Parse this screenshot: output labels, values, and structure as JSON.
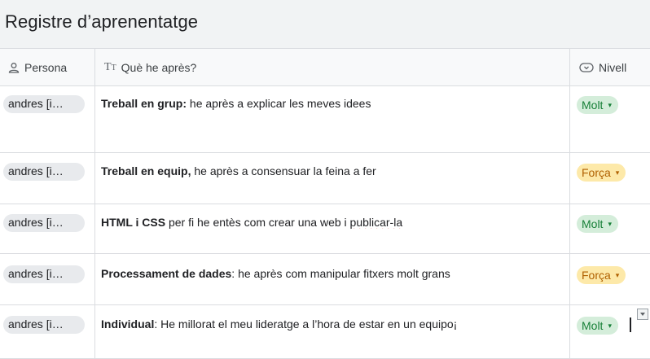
{
  "title": "Registre d’aprenentatge",
  "columns": {
    "persona": "Persona",
    "que": "Què he après?",
    "nivell": "Nivell"
  },
  "icons": {
    "persona": "person-icon",
    "que": "text-type-icon",
    "nivell": "dropdown-chip-icon"
  },
  "colors": {
    "molt_bg": "#d4edda",
    "molt_text": "#188038",
    "forca_bg": "#fde9a9",
    "forca_text": "#b06000"
  },
  "rows": [
    {
      "persona": "andres [i…",
      "bold": "Treball en grup:",
      "rest": " he après a explicar les meves idees",
      "nivell": "Molt"
    },
    {
      "persona": "andres [i…",
      "bold": "Treball en equip,",
      "rest": " he après a consensuar la feina a fer",
      "nivell": "Força"
    },
    {
      "persona": "andres [i…",
      "bold": "HTML i CSS",
      "rest": " per fi he entès com crear una web i ",
      "rest2": "publicar-la",
      "nivell": "Molt"
    },
    {
      "persona": "andres [i…",
      "bold": "Processament de dades",
      "rest": ": he après com manipular fitxers molt grans",
      "nivell": "Força"
    },
    {
      "persona": "andres [i…",
      "bold": "Individual",
      "rest": ": He millorat el meu lideratge a l’hora de estar en un equipo¡",
      "nivell": "Molt"
    }
  ]
}
